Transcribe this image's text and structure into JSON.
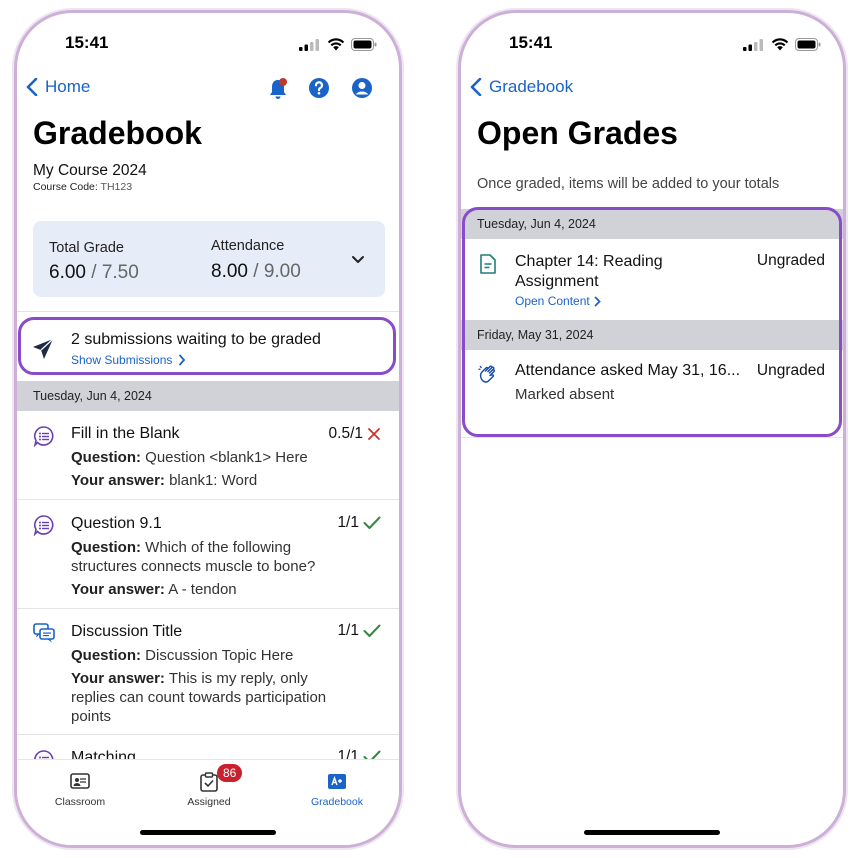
{
  "left": {
    "status": {
      "time": "15:41"
    },
    "nav": {
      "back_label": "Home"
    },
    "title": "Gradebook",
    "course": {
      "name": "My Course 2024",
      "code_label": "Course Code:",
      "code": "TH123"
    },
    "summary": {
      "total_label": "Total Grade",
      "total_value": "6.00",
      "total_max": "/ 7.50",
      "attendance_label": "Attendance",
      "attendance_value": "8.00",
      "attendance_max": "/ 9.00"
    },
    "submissions": {
      "text": "2 submissions waiting to be graded",
      "link": "Show Submissions"
    },
    "section_date": "Tuesday, Jun 4, 2024",
    "items": [
      {
        "title": "Fill in the Blank",
        "score": "0.5/1",
        "status": "incorrect",
        "question_label": "Question:",
        "question": "Question <blank1> Here",
        "answer_label": "Your answer:",
        "answer": "blank1: Word"
      },
      {
        "title": "Question 9.1",
        "score": "1/1",
        "status": "correct",
        "question_label": "Question:",
        "question": "Which of the following structures connects muscle to bone?",
        "answer_label": "Your answer:",
        "answer": "A - tendon"
      },
      {
        "title": "Discussion Title",
        "score": "1/1",
        "status": "correct",
        "question_label": "Question:",
        "question": "Discussion Topic Here",
        "answer_label": "Your answer:",
        "answer": "This is my reply, only replies can count towards participation points"
      },
      {
        "title": "Matching",
        "score": "1/1",
        "status": "correct"
      }
    ],
    "tabs": [
      {
        "label": "Classroom",
        "icon": "classroom-icon"
      },
      {
        "label": "Assigned",
        "icon": "assigned-icon",
        "badge": "86"
      },
      {
        "label": "Gradebook",
        "icon": "gradebook-icon",
        "active": true
      }
    ]
  },
  "right": {
    "status": {
      "time": "15:41"
    },
    "nav": {
      "back_label": "Gradebook"
    },
    "title": "Open Grades",
    "subtitle": "Once graded, items will be added to your totals",
    "sections": [
      {
        "date": "Tuesday, Jun 4, 2024",
        "item": {
          "title": "Chapter 14: Reading Assignment",
          "status": "Ungraded",
          "link": "Open Content"
        }
      },
      {
        "date": "Friday, May 31, 2024",
        "item": {
          "title": "Attendance asked May 31, 16...",
          "status": "Ungraded",
          "detail": "Marked absent"
        }
      }
    ]
  },
  "colors": {
    "accent": "#1a63c8",
    "highlight": "#8a4bc8",
    "correct": "#2f8a3c",
    "incorrect": "#d0302b",
    "badge": "#c8202d",
    "icon_purple": "#6b3fb0",
    "icon_teal": "#1f7f7a"
  }
}
